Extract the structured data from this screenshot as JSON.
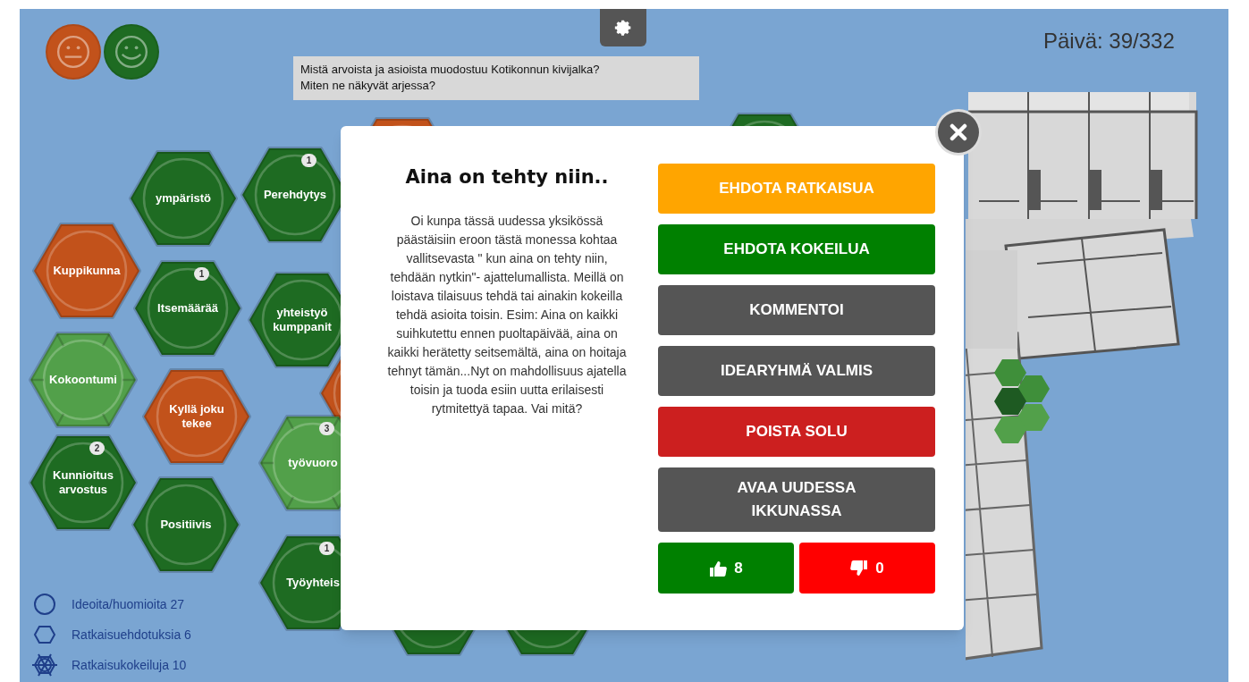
{
  "mood_buttons": [
    {
      "kind": "neutral",
      "color": "#c2521b"
    },
    {
      "kind": "happy",
      "color": "#1e6b22"
    }
  ],
  "question_lines": [
    "Mistä arvoista ja asioista muodostuu Kotikonnun kivijalka?",
    "Miten ne näkyvät arjessa?"
  ],
  "day_counter": "Päivä: 39/332",
  "cells": [
    {
      "kind": "idea",
      "color": "#c2521b"
    },
    {
      "kind": "idea",
      "color": "#1e6b22"
    },
    {
      "label": "ympäristö",
      "kind": "idea",
      "color": "#1e6b22"
    },
    {
      "label": "Perehdytys",
      "kind": "idea",
      "color": "#1e6b22",
      "comments": "1"
    },
    {
      "label": "Kuppikunna",
      "kind": "idea",
      "color": "#c2521b"
    },
    {
      "label": "Itsemäärää",
      "kind": "idea",
      "color": "#1e6b22",
      "comments": "1"
    },
    {
      "label": "yhteistyö kumppanit",
      "kind": "idea",
      "color": "#1e6b22"
    },
    {
      "label": "Kokoontumi",
      "kind": "trial",
      "color": "#52a04a"
    },
    {
      "kind": "idea",
      "color": "#c2521b"
    },
    {
      "label": "Kyllä joku tekee",
      "kind": "idea",
      "color": "#c2521b"
    },
    {
      "label": "työvuoro",
      "kind": "trial",
      "color": "#52a04a",
      "comments": "3"
    },
    {
      "label": "Kunnioitus arvostus",
      "kind": "idea",
      "color": "#1e6b22",
      "comments": "2"
    },
    {
      "label": "Positiivis",
      "kind": "idea",
      "color": "#1e6b22"
    },
    {
      "label": "Työyhteis",
      "kind": "idea",
      "color": "#1e6b22",
      "comments": "1"
    },
    {
      "kind": "idea",
      "color": "#1e6b22"
    },
    {
      "kind": "idea",
      "color": "#1e6b22"
    }
  ],
  "legend": [
    {
      "kind": "idea",
      "label": "Ideoita/huomioita 27"
    },
    {
      "kind": "solution",
      "label": "Ratkaisuehdotuksia 6"
    },
    {
      "kind": "trial",
      "label": "Ratkaisukokeiluja 10"
    }
  ],
  "modal": {
    "title": "Aina on tehty niin..",
    "body": "Oi kunpa tässä uudessa yksikössä päästäisiin eroon tästä monessa kohtaa vallitsevasta \" kun aina on tehty niin, tehdään nytkin\"- ajattelumallista. Meillä on loistava tilaisuus tehdä tai ainakin kokeilla tehdä asioita toisin. Esim: Aina on kaikki suihkutettu ennen puoltapäivää, aina on kaikki herätetty seitsemältä, aina on hoitaja tehnyt tämän...Nyt on mahdollisuus ajatella toisin ja tuoda esiin uutta erilaisesti rytmitettyä tapaa. Vai mitä?",
    "buttons": [
      {
        "label": "EHDOTA RATKAISUA",
        "color": "#ffa500"
      },
      {
        "label": "EHDOTA KOKEILUA",
        "color": "#008000"
      },
      {
        "label": "KOMMENTOI",
        "color": "#555555"
      },
      {
        "label": "IDEARYHMÄ VALMIS",
        "color": "#555555"
      },
      {
        "label": "POISTA SOLU",
        "color": "#cc1f1f"
      },
      {
        "label": "AVAA UUDESSA IKKUNASSA",
        "color": "#555555"
      }
    ],
    "likes": "8",
    "dislikes": "0"
  }
}
